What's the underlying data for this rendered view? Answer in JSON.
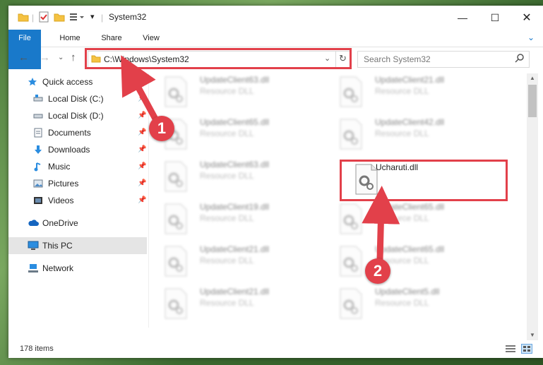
{
  "window": {
    "title": "System32"
  },
  "ribbon": {
    "tabs": [
      "File",
      "Home",
      "Share",
      "View"
    ]
  },
  "address": {
    "path": "C:\\Windows\\System32",
    "search_placeholder": "Search System32"
  },
  "sidebar": {
    "items": [
      {
        "label": "Quick access",
        "icon": "star-icon",
        "pinned": false
      },
      {
        "label": "Local Disk (C:)",
        "icon": "drive-icon",
        "pinned": true
      },
      {
        "label": "Local Disk (D:)",
        "icon": "drive-icon",
        "pinned": true
      },
      {
        "label": "Documents",
        "icon": "document-icon",
        "pinned": true
      },
      {
        "label": "Downloads",
        "icon": "download-icon",
        "pinned": true
      },
      {
        "label": "Music",
        "icon": "music-icon",
        "pinned": true
      },
      {
        "label": "Pictures",
        "icon": "pictures-icon",
        "pinned": true
      },
      {
        "label": "Videos",
        "icon": "videos-icon",
        "pinned": true
      },
      {
        "label": "OneDrive",
        "icon": "cloud-icon",
        "pinned": false
      },
      {
        "label": "This PC",
        "icon": "computer-icon",
        "pinned": false
      },
      {
        "label": "Network",
        "icon": "network-icon",
        "pinned": false
      }
    ]
  },
  "files": [
    {
      "name": "UpdateClient63.dll",
      "type": "Resource DLL"
    },
    {
      "name": "UpdateClient21.dll",
      "type": "Resource DLL"
    },
    {
      "name": "UpdateClient65.dll",
      "type": "Resource DLL"
    },
    {
      "name": "UpdateClient42.dll",
      "type": "Resource DLL"
    },
    {
      "name": "UpdateClient63.dll",
      "type": "Resource DLL"
    },
    {
      "name": "Ucharuti.dll",
      "type": ""
    },
    {
      "name": "UpdateClient19.dll",
      "type": "Resource DLL"
    },
    {
      "name": "UpdateClient65.dll",
      "type": "Resource DLL"
    },
    {
      "name": "UpdateClient21.dll",
      "type": "Resource DLL"
    },
    {
      "name": "UpdateClient65.dll",
      "type": "Resource DLL"
    },
    {
      "name": "UpdateClient21.dll",
      "type": "Resource DLL"
    },
    {
      "name": "UpdateClient5.dll",
      "type": "Resource DLL"
    }
  ],
  "status": {
    "item_count": "178 items"
  },
  "callouts": [
    "1",
    "2"
  ],
  "colors": {
    "accent": "#1979ca",
    "highlight": "#e2404a",
    "selected": "#e5e5e5"
  }
}
